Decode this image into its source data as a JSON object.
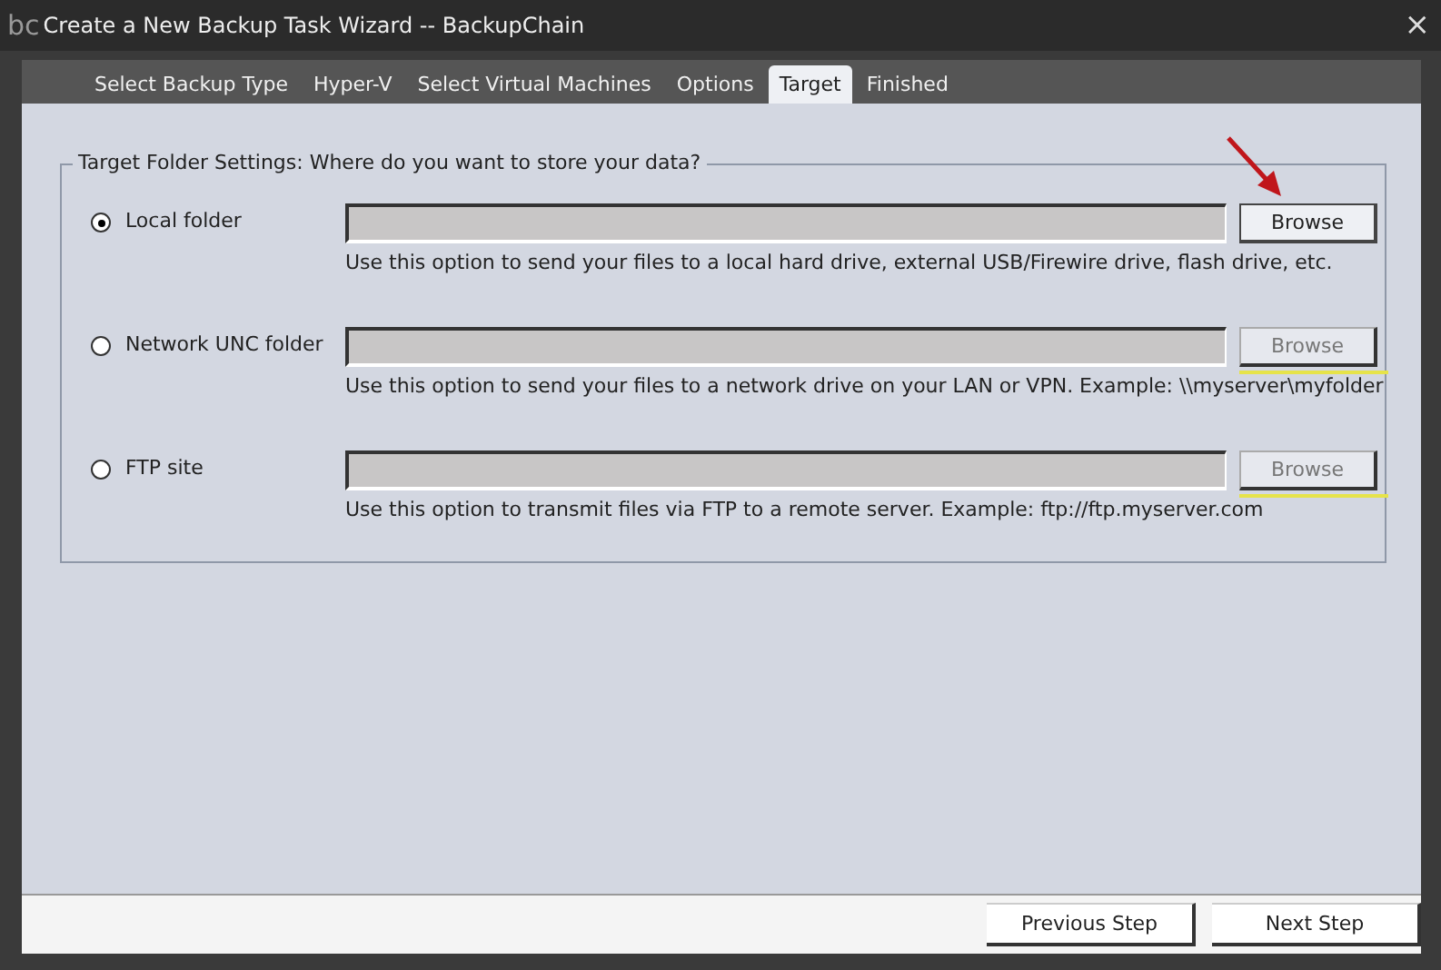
{
  "window": {
    "logo": "bc",
    "title": "Create a New Backup Task Wizard -- BackupChain",
    "close": "×"
  },
  "tabs": [
    {
      "label": "Select Backup Type",
      "selected": false
    },
    {
      "label": "Hyper-V",
      "selected": false
    },
    {
      "label": "Select Virtual Machines",
      "selected": false
    },
    {
      "label": "Options",
      "selected": false
    },
    {
      "label": "Target",
      "selected": true
    },
    {
      "label": "Finished",
      "selected": false
    }
  ],
  "group": {
    "title": "Target Folder Settings: Where do you want to store your data?"
  },
  "options": [
    {
      "label": "Local folder",
      "selected": true,
      "browse": "Browse",
      "browse_disabled": false,
      "kind": "arrow",
      "description": "Use this option to send your files to a local hard drive, external USB/Firewire drive, flash drive, etc."
    },
    {
      "label": "Network UNC folder",
      "selected": false,
      "browse": "Browse",
      "browse_disabled": true,
      "kind": "underline",
      "description": "Use this option to send your files to a network drive on your LAN or VPN. Example: \\\\myserver\\myfolder"
    },
    {
      "label": "FTP site",
      "selected": false,
      "browse": "Browse",
      "browse_disabled": true,
      "kind": "underline",
      "description": "Use this option to transmit files via FTP to a remote server. Example: ftp://ftp.myserver.com"
    }
  ],
  "buttons": [
    "Previous Step",
    "Next Step"
  ]
}
